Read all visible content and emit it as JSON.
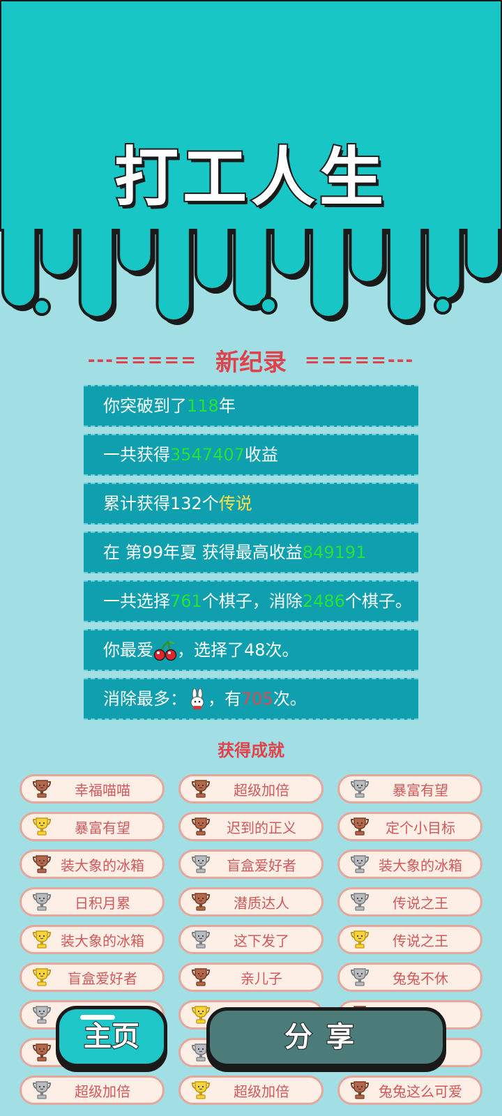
{
  "app": {
    "title": "打工人生"
  },
  "records": {
    "heading_left": "---=====",
    "heading_title": "新纪录",
    "heading_right": "=====---",
    "rows": [
      {
        "pre": "你突破到了",
        "hl": "118",
        "hl_color": "#25e236",
        "post": "年"
      },
      {
        "pre": "一共获得",
        "hl": "3547407",
        "hl_color": "#25e236",
        "post": "收益"
      },
      {
        "pre": "累计获得132个",
        "hl": "传说",
        "hl_color": "#ffe14a",
        "post": ""
      },
      {
        "pre": "在 第99年夏 获得最高收益",
        "hl": "849191",
        "hl_color": "#25e236",
        "post": ""
      },
      {
        "pre": "一共选择",
        "hl": "761",
        "hl_color": "#25e236",
        "mid": "个棋子，消除",
        "hl2": "2486",
        "post": "个棋子。"
      },
      {
        "pre": "你最爱",
        "icon": "cherry-icon",
        "post": "，选择了48次。"
      },
      {
        "pre": "消除最多：",
        "icon": "rabbit-icon",
        "mid": "，有",
        "hl": "705",
        "hl_color": "#e04a4f",
        "post": "次。"
      }
    ]
  },
  "achievements": {
    "heading": "获得成就",
    "items": [
      {
        "label": "幸福喵喵",
        "tier": "bronze"
      },
      {
        "label": "超级加倍",
        "tier": "bronze"
      },
      {
        "label": "暴富有望",
        "tier": "silver"
      },
      {
        "label": "暴富有望",
        "tier": "gold"
      },
      {
        "label": "迟到的正义",
        "tier": "bronze"
      },
      {
        "label": "定个小目标",
        "tier": "bronze"
      },
      {
        "label": "装大象的冰箱",
        "tier": "bronze"
      },
      {
        "label": "盲盒爱好者",
        "tier": "silver"
      },
      {
        "label": "装大象的冰箱",
        "tier": "silver"
      },
      {
        "label": "日积月累",
        "tier": "silver"
      },
      {
        "label": "潜质达人",
        "tier": "bronze"
      },
      {
        "label": "传说之王",
        "tier": "silver"
      },
      {
        "label": "装大象的冰箱",
        "tier": "gold"
      },
      {
        "label": "这下发了",
        "tier": "silver"
      },
      {
        "label": "传说之王",
        "tier": "gold"
      },
      {
        "label": "盲盒爱好者",
        "tier": "gold"
      },
      {
        "label": "亲儿子",
        "tier": "bronze"
      },
      {
        "label": "兔兔不休",
        "tier": "silver"
      },
      {
        "label": "",
        "tier": "silver"
      },
      {
        "label": "",
        "tier": "gold"
      },
      {
        "label": "",
        "tier": "bronze"
      },
      {
        "label": "",
        "tier": "bronze"
      },
      {
        "label": "",
        "tier": "silver"
      },
      {
        "label": "",
        "tier": "silver"
      },
      {
        "label": "超级加倍",
        "tier": "silver"
      },
      {
        "label": "超级加倍",
        "tier": "gold"
      },
      {
        "label": "兔兔这么可爱",
        "tier": "bronze"
      }
    ]
  },
  "buttons": {
    "home": "主页",
    "share": "分享"
  },
  "colors": {
    "header": "#18c6c6",
    "background": "#a2dfe4",
    "row": "#0f9fae",
    "accent": "#e0424c"
  }
}
